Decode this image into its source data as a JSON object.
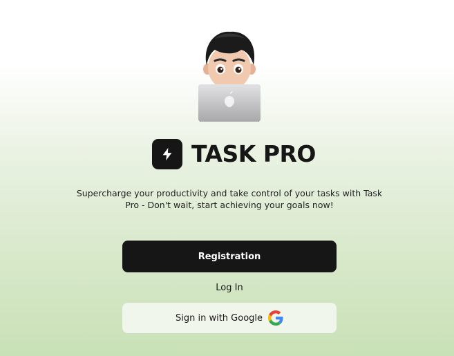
{
  "brand": {
    "title": "TASK PRO",
    "logo_icon": "lightning-bolt-icon"
  },
  "hero": {
    "avatar": "memoji-with-laptop",
    "tagline": "Supercharge your productivity and take control of your tasks with Task Pro - Don't wait, start achieving your goals now!"
  },
  "actions": {
    "registration_label": "Registration",
    "login_label": "Log In",
    "google_label": "Sign in with Google",
    "google_icon": "google-g-icon"
  },
  "colors": {
    "primary": "#161616",
    "background_bottom": "#c9e1b6",
    "google_button_bg": "#f1f6ec"
  }
}
